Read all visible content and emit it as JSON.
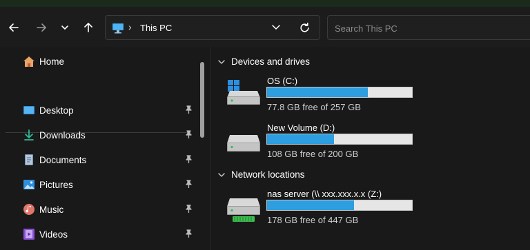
{
  "navigation": {
    "back_icon": "arrow-left-icon",
    "forward_icon": "arrow-right-icon",
    "recent_icon": "chevron-down-icon",
    "up_icon": "arrow-up-icon"
  },
  "address_bar": {
    "separator": "›",
    "path": "This PC",
    "icon": "this-pc-icon"
  },
  "search": {
    "placeholder": "Search This PC"
  },
  "sidebar": {
    "home": "Home",
    "quick_access": [
      {
        "label": "Desktop",
        "icon": "desktop-icon",
        "pinned": true
      },
      {
        "label": "Downloads",
        "icon": "download-icon",
        "pinned": true
      },
      {
        "label": "Documents",
        "icon": "documents-icon",
        "pinned": true
      },
      {
        "label": "Pictures",
        "icon": "pictures-icon",
        "pinned": true
      },
      {
        "label": "Music",
        "icon": "music-icon",
        "pinned": true
      },
      {
        "label": "Videos",
        "icon": "videos-icon",
        "pinned": true
      }
    ]
  },
  "content": {
    "devices_header": "Devices and drives",
    "network_header": "Network locations",
    "drives": [
      {
        "name": "OS (C:)",
        "free_text": "77.8 GB free of 257 GB",
        "used_fraction": 0.697,
        "icon": "system-drive-icon"
      },
      {
        "name": "New Volume (D:)",
        "free_text": "108 GB free of 200 GB",
        "used_fraction": 0.46,
        "icon": "hard-drive-icon"
      }
    ],
    "network": [
      {
        "name": "nas server (\\\\ xxx.xxx.x.x  (Z:)",
        "free_text": "178 GB free of 447 GB",
        "used_fraction": 0.602,
        "icon": "network-drive-icon"
      }
    ]
  },
  "colors": {
    "accent": "#2d9ee0",
    "background": "#191919",
    "bar_bg": "#e6e6e6"
  }
}
